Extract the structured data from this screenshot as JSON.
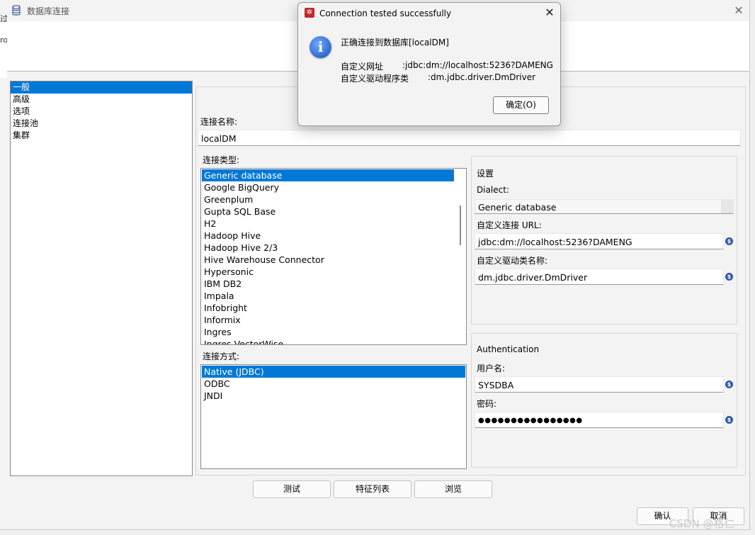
{
  "window": {
    "title": "数据库连接",
    "close_glyph": "✕"
  },
  "left_strip": {
    "glyph_1": "过",
    "glyph_2": "ro"
  },
  "categories": [
    "一般",
    "高级",
    "选项",
    "连接池",
    "集群"
  ],
  "connection_name": {
    "label": "连接名称:",
    "value": "localDM"
  },
  "connection_type": {
    "label": "连接类型:",
    "items": [
      "Generic database",
      "Google BigQuery",
      "Greenplum",
      "Gupta SQL Base",
      "H2",
      "Hadoop Hive",
      "Hadoop Hive 2/3",
      "Hive Warehouse Connector",
      "Hypersonic",
      "IBM DB2",
      "Impala",
      "Infobright",
      "Informix",
      "Ingres",
      "Ingres VectorWise"
    ],
    "selected": "Generic database"
  },
  "access": {
    "label": "连接方式:",
    "items": [
      "Native (JDBC)",
      "ODBC",
      "JNDI"
    ],
    "selected": "Native (JDBC)"
  },
  "settings": {
    "title": "设置",
    "dialect_label": "Dialect:",
    "dialect_value": "Generic database",
    "url_label": "自定义连接 URL:",
    "url_value": "jdbc:dm://localhost:5236?DAMENG",
    "driver_label": "自定义驱动类名称:",
    "driver_value": "dm.jdbc.driver.DmDriver"
  },
  "authentication": {
    "title": "Authentication",
    "user_label": "用户名:",
    "user_value": "SYSDBA",
    "password_label": "密码:",
    "password_value": "●●●●●●●●●●●●●●●●"
  },
  "variable_icon_glyph": "$",
  "buttons": {
    "test": "测试",
    "features": "特征列表",
    "explore": "浏览",
    "ok": "确认",
    "cancel": "取消"
  },
  "dialog": {
    "title": "Connection tested successfully",
    "close_glyph": "✕",
    "info_glyph": "i",
    "message": "正确连接到数据库[localDM]",
    "url_label": "自定义网址",
    "url_value": ":jdbc:dm://localhost:5236?DAMENG",
    "driver_label": "自定义驱动程序类",
    "driver_value": ":dm.jdbc.driver.DmDriver",
    "ok_button": "确定(O)"
  },
  "watermark": "CSDN @格仁",
  "colors": {
    "selection": "#0078d7",
    "dialog_icon": "#c62828",
    "info_icon": "#1a4fb8"
  }
}
